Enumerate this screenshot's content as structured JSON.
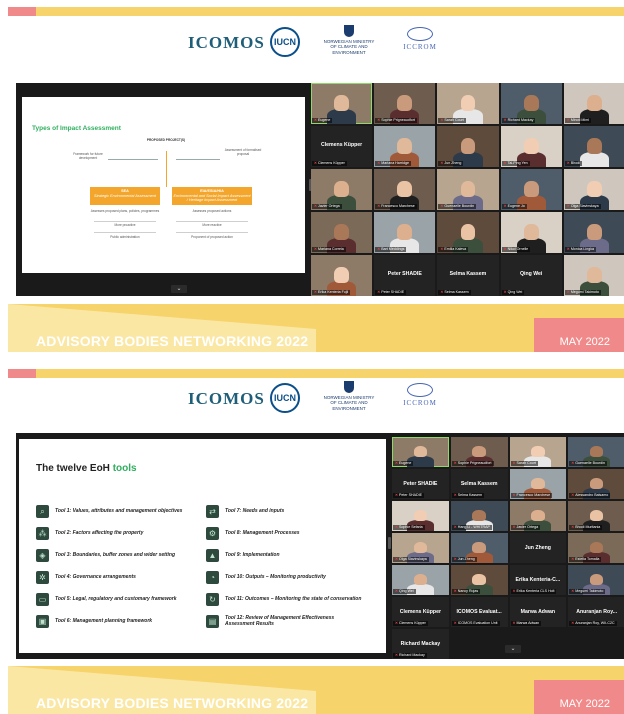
{
  "colors": {
    "accent_yellow": "#f6d36b",
    "accent_pink": "#f08a8a",
    "slide_green": "#2fae5e",
    "diagram_orange": "#f3a62b",
    "meeting_bg": "#1a1a1a"
  },
  "header": {
    "icomos": "ICOMOS",
    "iucn": "IUCN",
    "norway": "NORWEGIAN MINISTRY OF CLIMATE AND ENVIRONMENT",
    "iccrom": "ICCROM"
  },
  "footer": {
    "title": "ADVISORY BODIES NETWORKING 2022",
    "date": "MAY 2022"
  },
  "panel1": {
    "slide": {
      "title": "Types of Impact Assessment",
      "proposed": "PROPOSED PROJECT(S)",
      "framework": "Framework for future development",
      "assessment": "Assessment of formalised proposal",
      "sea_title": "SEA",
      "sea_sub": "Strategic Environmental Assessment",
      "eia_title": "EIA/ESIA/HIA",
      "eia_sub": "Environmental and Social Impact Assessment / Heritage Impact Assessment",
      "sea_assesses": "Assesses proposed plans, policies, programmes",
      "eia_assesses": "Assesses proposed actions",
      "more_proactive": "More proactive",
      "more_reactive": "More reactive",
      "public_admin": "Public administration",
      "proponent": "Proponent of proposed action"
    },
    "tiles": [
      {
        "label": "Eugene",
        "kind": "video"
      },
      {
        "label": "Sophie Prigneaudfort",
        "kind": "video"
      },
      {
        "label": "Sarah Court",
        "kind": "video"
      },
      {
        "label": "Richard Mackay",
        "kind": "video"
      },
      {
        "label": "Minoti Mimi",
        "kind": "video"
      },
      {
        "name": "Clemens Küpper",
        "label": "Clemens Küpper",
        "kind": "name"
      },
      {
        "label": "Mariana Harridge",
        "kind": "video"
      },
      {
        "label": "Jun Zheng",
        "kind": "video"
      },
      {
        "label": "Tai-Ping Yen",
        "kind": "video"
      },
      {
        "label": "Bhodi",
        "kind": "video"
      },
      {
        "label": "Javier Ortega",
        "kind": "video"
      },
      {
        "label": "Francesco Marchese",
        "kind": "video"
      },
      {
        "label": "Guenaelle Bourdin",
        "kind": "video"
      },
      {
        "label": "Eugene Jo",
        "kind": "video"
      },
      {
        "label": "Olga Slavinskaya",
        "kind": "video"
      },
      {
        "label": "Mariana Correia",
        "kind": "video"
      },
      {
        "label": "Bart Meddings",
        "kind": "video"
      },
      {
        "label": "Emilia Kaleva",
        "kind": "video"
      },
      {
        "label": "Nikol Ornelle",
        "kind": "video"
      },
      {
        "label": "Monica Lingka",
        "kind": "video"
      },
      {
        "label": "Erika Kenteria Fujii",
        "kind": "video"
      },
      {
        "name": "Peter SHADIE",
        "label": "Peter SHADIE",
        "kind": "name"
      },
      {
        "name": "Selma Kassem",
        "label": "Selma Kassem",
        "kind": "name"
      },
      {
        "name": "Qing Wei",
        "label": "Qing Wei",
        "kind": "name"
      },
      {
        "label": "Megumi Takimoto",
        "kind": "video"
      }
    ]
  },
  "panel2": {
    "slide": {
      "title_main": "The twelve EoH ",
      "title_accent": "tools",
      "tools": [
        {
          "label": "Tool 1: Values, attributes and management objectives",
          "icon": "magnifier-icon",
          "glyph": "⌕"
        },
        {
          "label": "Tool 2: Factors affecting the property",
          "icon": "network-icon",
          "glyph": "⁂"
        },
        {
          "label": "Tool 3: Boundaries, buffer zones and wider setting",
          "icon": "map-icon",
          "glyph": "◈"
        },
        {
          "label": "Tool 4: Governance arrangements",
          "icon": "gear-icon",
          "glyph": "✲"
        },
        {
          "label": "Tool 5: Legal, regulatory and customary framework",
          "icon": "scroll-icon",
          "glyph": "▭"
        },
        {
          "label": "Tool 6: Management planning framework",
          "icon": "presentation-icon",
          "glyph": "▣"
        },
        {
          "label": "Tool 7: Needs and inputs",
          "icon": "arrows-icon",
          "glyph": "⇄"
        },
        {
          "label": "Tool 8: Management Processes",
          "icon": "process-icon",
          "glyph": "⚙"
        },
        {
          "label": "Tool 9: Implementation",
          "icon": "mountain-icon",
          "glyph": "▲"
        },
        {
          "label": "Tool 10: Outputs – Monitoring productivity",
          "icon": "gauge-icon",
          "glyph": "◔"
        },
        {
          "label": "Tool 11: Outcomes – Monitoring the state of conservation",
          "icon": "refresh-icon",
          "glyph": "↻"
        },
        {
          "label": "Tool 12: Review of Management Effectiveness Assessment Results",
          "icon": "document-icon",
          "glyph": "▤"
        }
      ]
    },
    "tiles": [
      {
        "label": "Eugene",
        "kind": "video"
      },
      {
        "label": "Sophie Prigneaudfort",
        "kind": "video"
      },
      {
        "label": "Sarah Court",
        "kind": "video"
      },
      {
        "label": "Guenaelle Bourdin",
        "kind": "video"
      },
      {
        "name": "Peter SHADIE",
        "label": "Peter SHADIE",
        "kind": "name"
      },
      {
        "name": "Selma Kassem",
        "label": "Selma Kassem",
        "kind": "name"
      },
      {
        "label": "Francesco Marchese",
        "kind": "video"
      },
      {
        "label": "Alessandro Balsamo",
        "kind": "video"
      },
      {
        "label": "Sophie Sefaria",
        "kind": "video"
      },
      {
        "label": "Hang Li - WHITRAP",
        "kind": "video"
      },
      {
        "label": "Javier Ortega",
        "kind": "video"
      },
      {
        "label": "Bhodi Muritania",
        "kind": "video"
      },
      {
        "label": "Olga Slavinskaya",
        "kind": "video"
      },
      {
        "label": "Jun Zheng",
        "kind": "video"
      },
      {
        "name": "Jun Zheng",
        "label": "Jun Zheng",
        "kind": "name_only"
      },
      {
        "label": "Estella Tomalla",
        "kind": "video"
      },
      {
        "label": "Qing Wei",
        "kind": "video"
      },
      {
        "label": "Nancy Rojas",
        "kind": "video"
      },
      {
        "name": "Erika Kenteria-C...",
        "label": "Erika Kenteria CLS Holt",
        "kind": "name"
      },
      {
        "label": "Megumi Takimoto",
        "kind": "video"
      },
      {
        "name": "Clemens Küpper",
        "label": "Clemens Küpper",
        "kind": "name"
      },
      {
        "name": "ICOMOS Evaluat...",
        "label": "ICOMOS Evaluation Unit",
        "kind": "name"
      },
      {
        "name": "Marwa Adwan",
        "label": "Marwa Adwan",
        "kind": "name"
      },
      {
        "name": "Anuranjan Roy...",
        "label": "Anuranjan Roy, WII-C2C",
        "kind": "name"
      },
      {
        "name": "Richard Mackay",
        "label": "Richard Mackay",
        "kind": "name"
      }
    ]
  },
  "ui": {
    "more_glyph": "⌄"
  }
}
